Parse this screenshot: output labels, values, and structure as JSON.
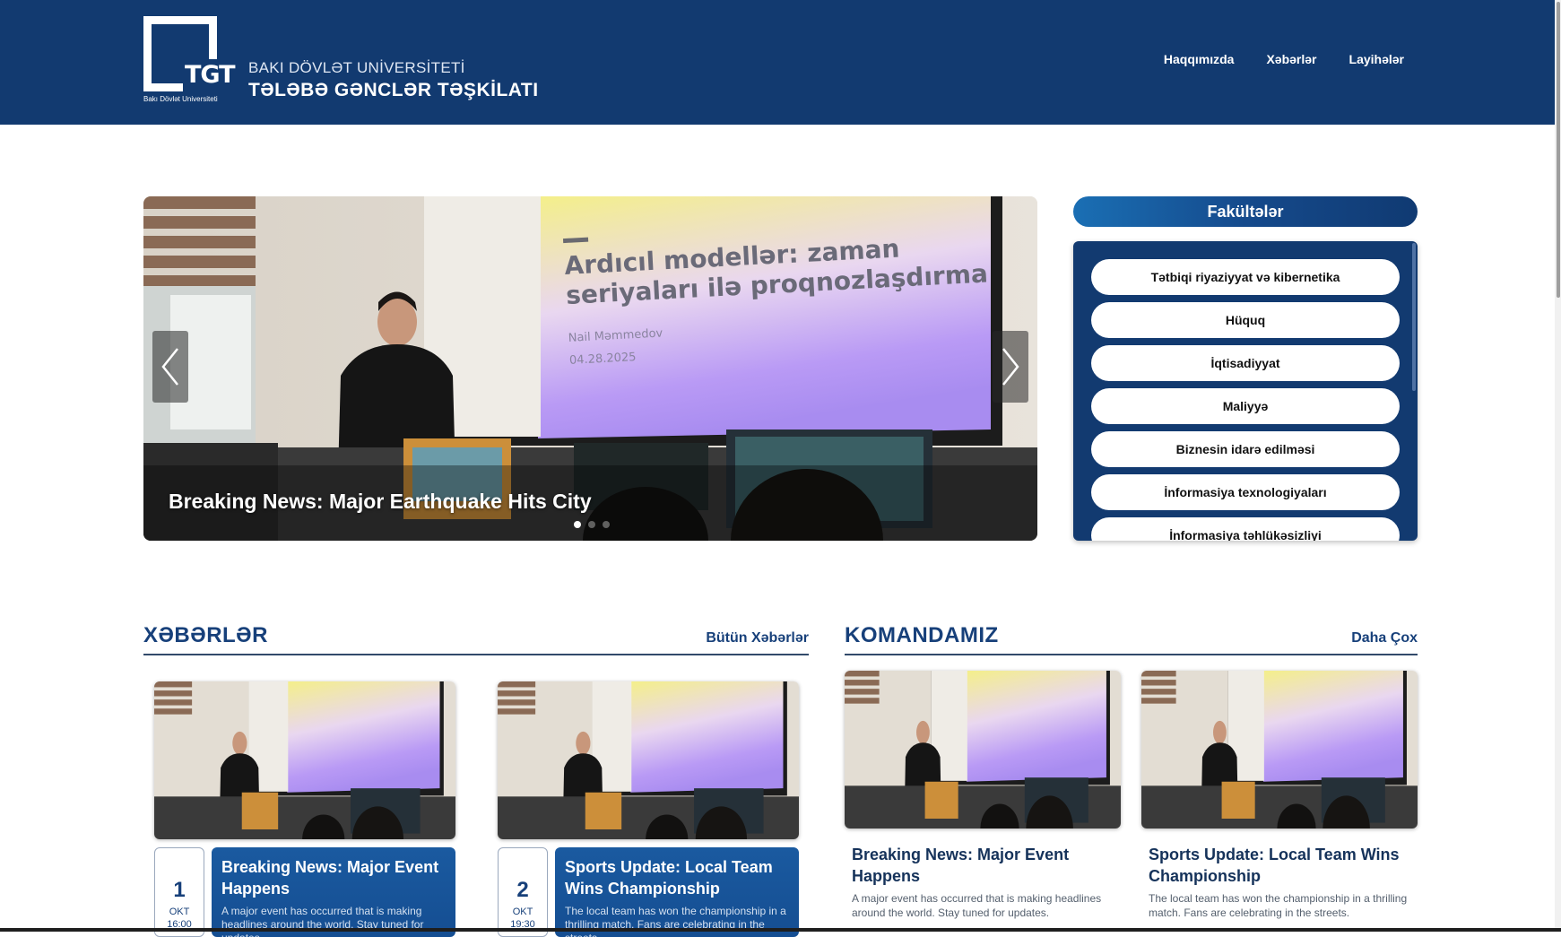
{
  "header": {
    "logo_text": "TGT",
    "logo_subtitle": "Bakı Dövlət Universiteti",
    "org_line1": "BAKI DÖVLƏT UNİVERSİTETİ",
    "org_line2": "TƏLƏBƏ GƏNCLƏR TƏŞKİLATI",
    "nav": [
      "Haqqımızda",
      "Xəbərlər",
      "Layihələr"
    ]
  },
  "slider": {
    "caption": "Breaking News: Major Earthquake Hits City",
    "slide_title_line1": "Ardıcıl modellər: zaman",
    "slide_title_line2": "seriyaları ilə proqnozlaşdırma",
    "slide_author": "Nail Məmmedov",
    "slide_date": "04.28.2025",
    "dots": 3,
    "active_dot": 0,
    "prev_icon": "chevron-left-icon",
    "next_icon": "chevron-right-icon"
  },
  "faculties": {
    "title": "Fakültələr",
    "items": [
      "Tətbiqi riyaziyyat və kibernetika",
      "Hüquq",
      "İqtisadiyyat",
      "Maliyyə",
      "Biznesin idarə edilməsi",
      "İnformasiya texnologiyaları",
      "İnformasiya təhlükəsizliyi"
    ]
  },
  "news": {
    "title": "XƏBƏRLƏR",
    "link": "Bütün Xəbərlər",
    "cards": [
      {
        "day": "1",
        "month": "OKT",
        "time": "16:00",
        "title": "Breaking News: Major Event Happens",
        "desc": "A major event has occurred that is making headlines around the world. Stay tuned for updates."
      },
      {
        "day": "2",
        "month": "OKT",
        "time": "19:30",
        "title": "Sports Update: Local Team Wins Championship",
        "desc": "The local team has won the championship in a thrilling match. Fans are celebrating in the streets."
      }
    ]
  },
  "team": {
    "title": "KOMANDAMIZ",
    "link": "Daha Çox",
    "cards": [
      {
        "title": "Breaking News: Major Event Happens",
        "desc": "A major event has occurred that is making headlines around the world. Stay tuned for updates."
      },
      {
        "title": "Sports Update: Local Team Wins Championship",
        "desc": "The local team has won the championship in a thrilling match. Fans are celebrating in the streets."
      }
    ]
  },
  "colors": {
    "header_bg": "#123a70",
    "accent": "#17407a",
    "card_blue": "#1a5aa0"
  }
}
